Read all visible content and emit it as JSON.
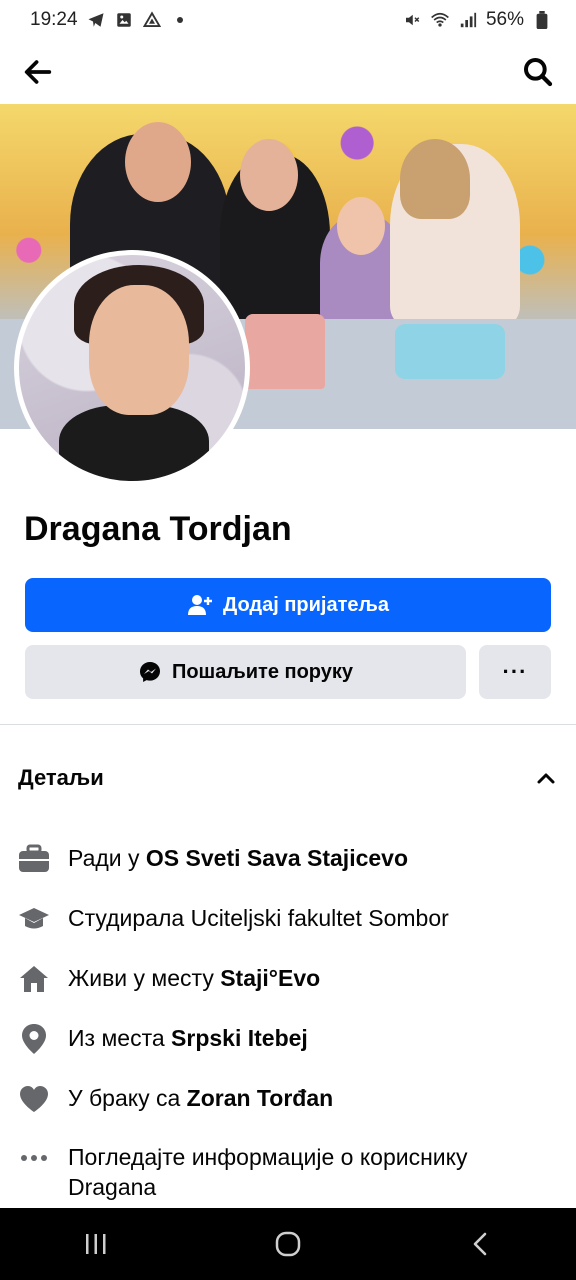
{
  "status_bar": {
    "time": "19:24",
    "battery": "56%",
    "notification_icons": [
      "telegram-icon",
      "gallery-icon",
      "drive-icon",
      "dot-icon"
    ],
    "system_icons": [
      "mute-icon",
      "wifi-icon",
      "signal-icon",
      "battery-icon"
    ]
  },
  "app_bar": {
    "back_icon": "arrow-left-icon",
    "search_icon": "search-icon"
  },
  "profile": {
    "name": "Dragana Tordjan"
  },
  "actions": {
    "add_friend_label": "Додај пријатеља",
    "message_label": "Пошаљите поруку",
    "more_label": "···"
  },
  "details": {
    "title": "Детаљи",
    "items": [
      {
        "icon": "briefcase-icon",
        "prefix": "Ради у ",
        "highlight": "OS Sveti Sava Stajicevo"
      },
      {
        "icon": "graduation-cap-icon",
        "prefix": "Студирала Uciteljski fakultet Sombor",
        "highlight": ""
      },
      {
        "icon": "home-icon",
        "prefix": "Живи у месту ",
        "highlight": "Staji°Evo"
      },
      {
        "icon": "location-pin-icon",
        "prefix": "Из места ",
        "highlight": "Srpski Itebej"
      },
      {
        "icon": "heart-icon",
        "prefix": "У браку са ",
        "highlight": "Zoran Torđan"
      },
      {
        "icon": "more-dots-icon",
        "prefix": "Погледајте информације о кориснику Dragana",
        "highlight": ""
      }
    ]
  },
  "colors": {
    "primary": "#0866ff",
    "secondary_bg": "#e4e6eb",
    "icon_gray": "#65676b",
    "text": "#050505"
  }
}
